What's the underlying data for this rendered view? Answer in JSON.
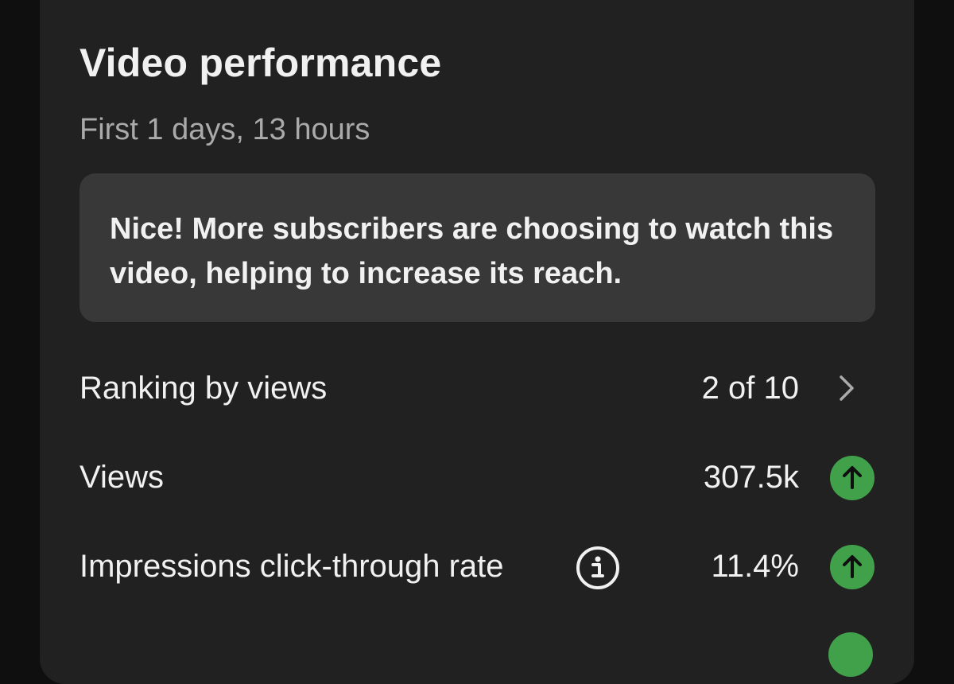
{
  "card": {
    "title": "Video performance",
    "subtitle": "First 1 days, 13 hours",
    "insight": "Nice! More subscribers are choosing to watch this video, helping to increase its reach."
  },
  "metrics": [
    {
      "label": "Ranking by views",
      "value": "2 of 10",
      "icon": "chevron-right-icon"
    },
    {
      "label": "Views",
      "value": "307.5k",
      "icon": "arrow-up-icon",
      "trend": "up"
    },
    {
      "label": "Impressions click-through rate",
      "value": "11.4%",
      "icon": "arrow-up-icon",
      "trend": "up",
      "info_icon": "info-icon"
    }
  ],
  "colors": {
    "background": "#0f0f0f",
    "card": "#212121",
    "insight_box": "#383838",
    "text_primary": "#f1f1f1",
    "text_secondary": "#aaaaaa",
    "trend_up": "#41a14a"
  }
}
